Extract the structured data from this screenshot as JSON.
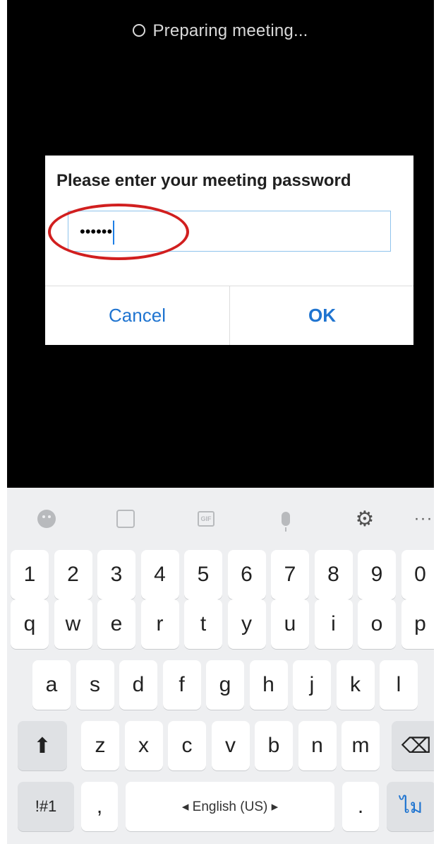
{
  "status": {
    "text": "Preparing meeting..."
  },
  "dialog": {
    "title": "Please enter your meeting password",
    "password_value": "••••••",
    "cancel_label": "Cancel",
    "ok_label": "OK"
  },
  "keyboard": {
    "toolbar": {
      "emoji_icon": "emoji-icon",
      "sticker_icon": "sticker-icon",
      "gif_label": "GIF",
      "mic_icon": "microphone-icon",
      "settings_icon": "gear-icon",
      "more_label": "···"
    },
    "row_numbers": [
      "1",
      "2",
      "3",
      "4",
      "5",
      "6",
      "7",
      "8",
      "9",
      "0"
    ],
    "row_top": [
      "q",
      "w",
      "e",
      "r",
      "t",
      "y",
      "u",
      "i",
      "o",
      "p"
    ],
    "row_home": [
      "a",
      "s",
      "d",
      "f",
      "g",
      "h",
      "j",
      "k",
      "l"
    ],
    "row_bottom": [
      "z",
      "x",
      "c",
      "v",
      "b",
      "n",
      "m"
    ],
    "shift_label": "⬆",
    "backspace_label": "⌫",
    "symbols_label": "!#1",
    "comma_label": ",",
    "space_label": "◂ English (US) ▸",
    "period_label": ".",
    "language_label": "ไม"
  },
  "colors": {
    "accent": "#1f74d0",
    "annotation": "#d11f1f",
    "input_border": "#8fc3ec"
  }
}
